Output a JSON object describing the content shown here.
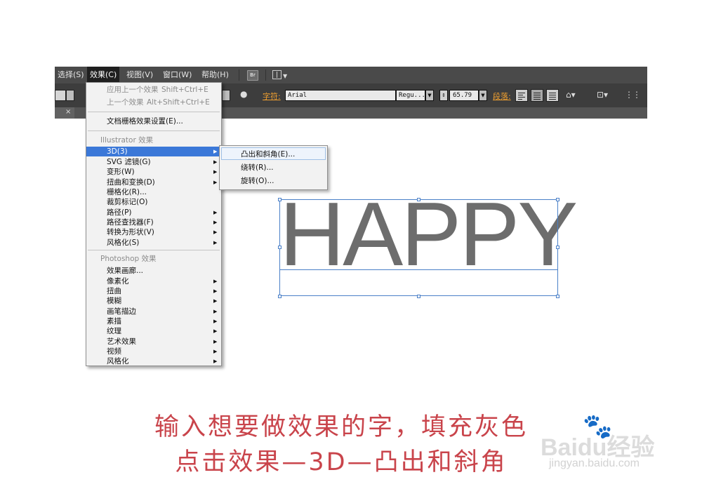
{
  "menubar": {
    "items": [
      "选择(S)",
      "效果(C)",
      "视图(V)",
      "窗口(W)",
      "帮助(H)"
    ],
    "bridge_label": "Br"
  },
  "controlbar": {
    "char_label": "字符:",
    "font_name": "Arial",
    "font_style": "Regu...",
    "font_size": "65.79",
    "para_label": "段落:"
  },
  "effects_menu": {
    "items": [
      {
        "label": "应用上一个效果",
        "shortcut": "Shift+Ctrl+E",
        "state": "disabled"
      },
      {
        "label": "上一个效果",
        "shortcut": "Alt+Shift+Ctrl+E",
        "state": "disabled"
      },
      {
        "label": "文档栅格效果设置(E)...",
        "shortcut": "",
        "state": "normal"
      },
      {
        "label": "Illustrator 效果",
        "state": "header"
      },
      {
        "label": "3D(3)",
        "submenu": true,
        "state": "highlighted"
      },
      {
        "label": "SVG 滤镜(G)",
        "submenu": true
      },
      {
        "label": "变形(W)",
        "submenu": true
      },
      {
        "label": "扭曲和变换(D)",
        "submenu": true
      },
      {
        "label": "栅格化(R)..."
      },
      {
        "label": "裁剪标记(O)"
      },
      {
        "label": "路径(P)",
        "submenu": true
      },
      {
        "label": "路径查找器(F)",
        "submenu": true
      },
      {
        "label": "转换为形状(V)",
        "submenu": true
      },
      {
        "label": "风格化(S)",
        "submenu": true
      },
      {
        "label": "Photoshop 效果",
        "state": "header"
      },
      {
        "label": "效果画廊..."
      },
      {
        "label": "像素化",
        "submenu": true
      },
      {
        "label": "扭曲",
        "submenu": true
      },
      {
        "label": "模糊",
        "submenu": true
      },
      {
        "label": "画笔描边",
        "submenu": true
      },
      {
        "label": "素描",
        "submenu": true
      },
      {
        "label": "纹理",
        "submenu": true
      },
      {
        "label": "艺术效果",
        "submenu": true
      },
      {
        "label": "视频",
        "submenu": true
      },
      {
        "label": "风格化",
        "submenu": true
      }
    ]
  },
  "submenu_3d": {
    "items": [
      "凸出和斜角(E)...",
      "绕转(R)...",
      "旋转(O)..."
    ],
    "highlighted_index": 0
  },
  "canvas": {
    "text": "HAPPY"
  },
  "caption": {
    "line1": "输入想要做效果的字，填充灰色",
    "line2": "点击效果—3D—凸出和斜角"
  },
  "watermark": {
    "logo": "Baidu经验",
    "site": "jingyan.baidu.com"
  },
  "colors": {
    "menubar_bg": "#4a4a4a",
    "menu_highlight": "#3b78d8",
    "caption": "#c9444b",
    "selection": "#4a80c8",
    "label_orange": "#f0a030"
  }
}
